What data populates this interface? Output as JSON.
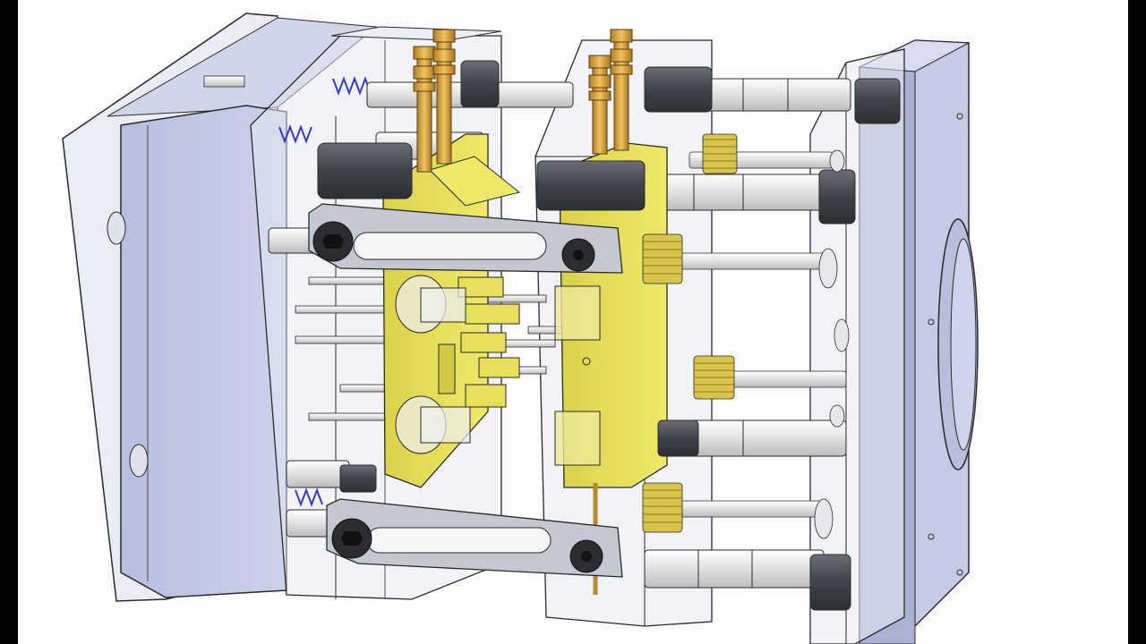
{
  "scene": {
    "subject": "",
    "background": "#fdfdfd",
    "letterbox": "#000000"
  },
  "colors": {
    "plate": "#c9cfe6",
    "plate_dark": "#aab2d2",
    "glass": "#e4e8f0",
    "cavity_insert": "#e6e05a",
    "cavity_insert_dark": "#c8c23a",
    "brass_fitting": "#d6a542",
    "spring": "#d8c44a",
    "blue_spring": "#3a3ad0",
    "steel": "#e8e8e8",
    "dark_part": "#4a4e55",
    "link_bar": "#c4c8d0",
    "outline": "#2a2a2a"
  }
}
